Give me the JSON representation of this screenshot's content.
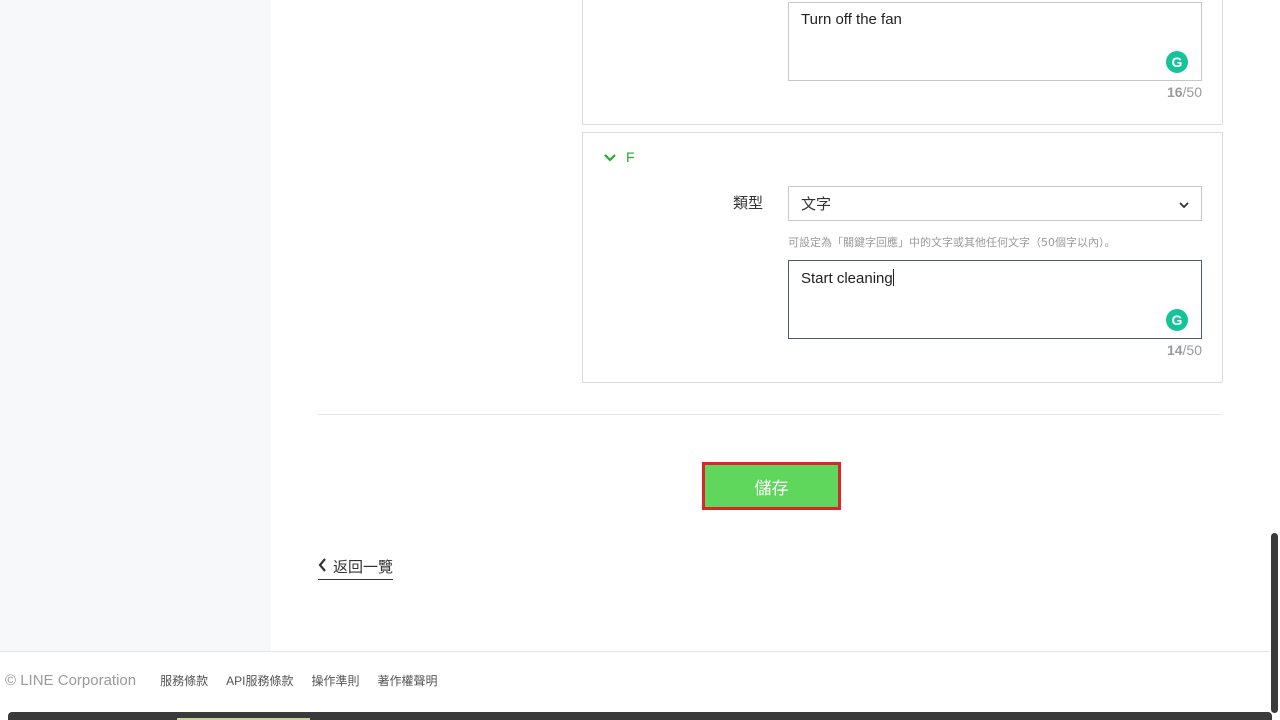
{
  "cards": {
    "e": {
      "text_value": "Turn off the fan",
      "counter_current": "16",
      "counter_max": "/50"
    },
    "f": {
      "section_label": "F",
      "type_label": "類型",
      "type_value": "文字",
      "hint": "可設定為「關鍵字回應」中的文字或其他任何文字（50個字以內）。",
      "text_value": "Start cleaning",
      "counter_current": "14",
      "counter_max": "/50"
    }
  },
  "actions": {
    "save_label": "儲存",
    "back_label": "返回一覽"
  },
  "footer": {
    "copyright": "© LINE Corporation",
    "links": [
      "服務條款",
      "API服務條款",
      "操作準則",
      "著作權聲明"
    ]
  },
  "icons": {
    "grammarly": "G",
    "collapse": "chevron-down-icon",
    "select_arrow": "chevron-down-icon",
    "back": "chevron-left-icon"
  },
  "colors": {
    "accent_green": "#1fad2b",
    "save_bg": "#5fd65c",
    "save_border": "#d9262b",
    "grammarly": "#15c39a"
  }
}
